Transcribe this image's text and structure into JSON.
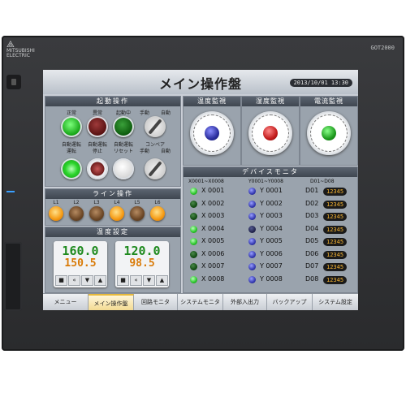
{
  "device": {
    "brand_line1": "MITSUBISHI",
    "brand_line2": "ELECTRIC",
    "model": "GOT2000"
  },
  "screen": {
    "title": "メイン操作盤",
    "datetime": "2013/10/01 13:30"
  },
  "panels": {
    "start_op": {
      "title": "起動操作",
      "row1_labels": [
        "正常",
        "異常",
        "起動中",
        "手動",
        "自動"
      ],
      "row2_labels": [
        "自動運転",
        "自動運転",
        "自動運転",
        "コンベア",
        "自動"
      ],
      "row3_labels": [
        "運転",
        "停止",
        "リセット",
        "手動",
        ""
      ]
    },
    "line_op": {
      "title": "ライン操作",
      "labels": [
        "L1",
        "L2",
        "L3",
        "L4",
        "L5",
        "L6"
      ]
    },
    "temp_setting": {
      "title": "温度設定",
      "boxes": [
        {
          "set": "160.0",
          "current": "150.5"
        },
        {
          "set": "120.0",
          "current": "98.5"
        }
      ],
      "controls": [
        "■",
        "«",
        "▼",
        "▲"
      ]
    },
    "gauges": [
      {
        "title": "温度監視"
      },
      {
        "title": "湿度監視"
      },
      {
        "title": "電流監視"
      }
    ],
    "device_monitor": {
      "title": "デバイスモニタ",
      "col_headers": [
        "X0001~X0008",
        "Y0001~Y0008",
        "D01~D08"
      ],
      "x_items": [
        "X 0001",
        "X 0002",
        "X 0003",
        "X 0004",
        "X 0005",
        "X 0006",
        "X 0007",
        "X 0008"
      ],
      "x_states": [
        "on",
        "off",
        "off",
        "on",
        "on",
        "off",
        "off",
        "on"
      ],
      "y_items": [
        "Y 0001",
        "Y 0002",
        "Y 0003",
        "Y 0004",
        "Y 0005",
        "Y 0006",
        "Y 0007",
        "Y 0008"
      ],
      "y_states": [
        "on",
        "on",
        "on",
        "off",
        "on",
        "on",
        "on",
        "on"
      ],
      "d_items": [
        "D01",
        "D02",
        "D03",
        "D04",
        "D05",
        "D06",
        "D07",
        "D08"
      ],
      "d_values": [
        "12345",
        "12345",
        "12345",
        "12345",
        "12345",
        "12345",
        "12345",
        "12345"
      ]
    }
  },
  "tabs": [
    {
      "label": "メニュー",
      "active": false
    },
    {
      "label": "メイン操作盤",
      "active": true
    },
    {
      "label": "回路モニタ",
      "active": false
    },
    {
      "label": "システムモニタ",
      "active": false
    },
    {
      "label": "外部入出力",
      "active": false
    },
    {
      "label": "バックアップ",
      "active": false
    },
    {
      "label": "システム設定",
      "active": false
    }
  ]
}
